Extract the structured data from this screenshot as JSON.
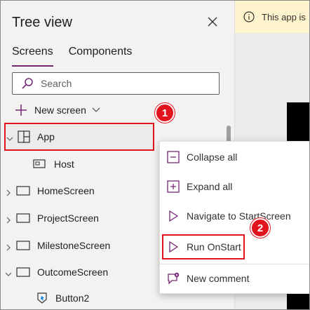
{
  "panel": {
    "title": "Tree view",
    "tabs": [
      {
        "label": "Screens",
        "active": true
      },
      {
        "label": "Components",
        "active": false
      }
    ],
    "search_placeholder": "Search",
    "new_screen_label": "New screen"
  },
  "tree": [
    {
      "label": "App"
    },
    {
      "label": "Host"
    },
    {
      "label": "HomeScreen"
    },
    {
      "label": "ProjectScreen"
    },
    {
      "label": "MilestoneScreen"
    },
    {
      "label": "OutcomeScreen"
    },
    {
      "label": "Button2"
    }
  ],
  "notice": {
    "text": "This app is"
  },
  "context_menu": {
    "items": [
      {
        "label": "Collapse all",
        "icon": "collapse-icon"
      },
      {
        "label": "Expand all",
        "icon": "expand-icon"
      },
      {
        "label": "Navigate to StartScreen",
        "icon": "play-icon"
      },
      {
        "label": "Run OnStart",
        "icon": "play-icon"
      },
      {
        "label": "New comment",
        "icon": "comment-icon"
      }
    ]
  },
  "callouts": [
    "1",
    "2"
  ],
  "colors": {
    "accent": "#742774",
    "highlight": "#e1141e",
    "panel_bg": "#f3f2f1",
    "notice_bg": "#fff4ce"
  }
}
